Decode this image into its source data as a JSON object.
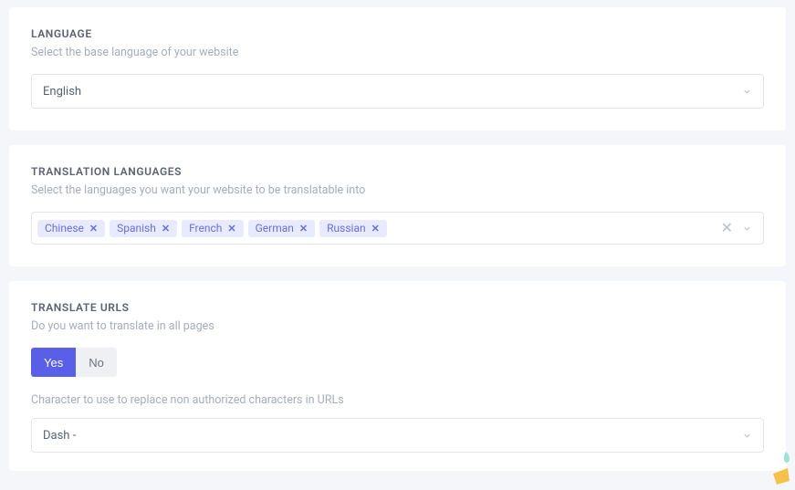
{
  "language": {
    "title": "LANGUAGE",
    "desc": "Select the base language of your website",
    "selected": "English"
  },
  "translation": {
    "title": "TRANSLATION LANGUAGES",
    "desc": "Select the languages you want your website to be translatable into",
    "tags": [
      "Chinese",
      "Spanish",
      "French",
      "German",
      "Russian"
    ]
  },
  "urls": {
    "title": "TRANSLATE URLS",
    "desc": "Do you want to translate in all pages",
    "yes": "Yes",
    "no": "No",
    "char_desc": "Character to use to replace non authorized characters in URLs",
    "char_selected": "Dash -"
  },
  "icons": {
    "remove": "✕",
    "clear": "✕"
  }
}
